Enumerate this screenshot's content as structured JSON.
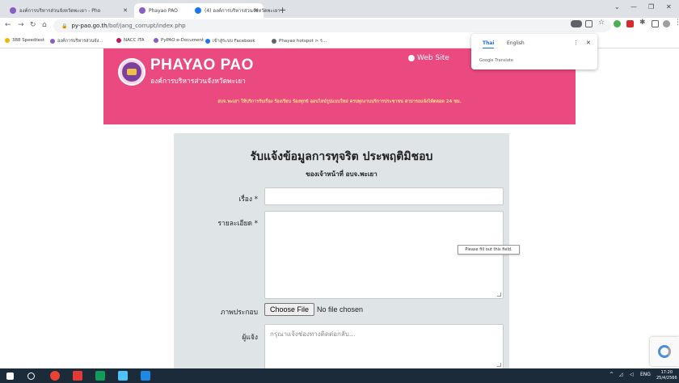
{
  "browser": {
    "tabs": [
      {
        "title": "องค์การบริหารส่วนจังหวัดพะเยา - Pho",
        "active": false,
        "favicon_color": "#8a5cc4"
      },
      {
        "title": "Phayao PAO",
        "active": true,
        "favicon_color": "#8a5cc4"
      },
      {
        "title": "(4) องค์การบริหารส่วนจังหวัดพะเยา | F",
        "active": false,
        "favicon_color": "#1877f2"
      }
    ],
    "new_tab": "+",
    "url_host": "py-pao.go.th",
    "url_path": "/bof/jang_corrupt/index.php",
    "bookmarks": [
      {
        "label": "388 Speedtest",
        "color": "#f4b400"
      },
      {
        "label": "องค์การบริหารส่วนจัง...",
        "color": "#8a5cc4"
      },
      {
        "label": "NACC ITA",
        "color": "#c2185b"
      },
      {
        "label": "PyPAO e-Document",
        "color": "#8a5cc4"
      },
      {
        "label": "เข้าสู่ระบบ Facebook",
        "color": "#1877f2"
      },
      {
        "label": "Phayao hotspot > ร...",
        "color": "#5f6368"
      }
    ],
    "translate_popup": {
      "lang_active": "Thai",
      "lang_other": "English",
      "brand": "Google Translate"
    }
  },
  "site": {
    "logo_title": "PHAYAO PAO",
    "logo_subtitle": "องค์การบริหารส่วนจังหวัดพะเยา",
    "website_link": "Web Site",
    "strip_text": "อบจ.พะเยา ให้บริการรับเรื่อง ร้องเรียน ร้องทุกข์ ออนไลน์รูปแบบใหม่ ครบทุกงานบริการประชาชน สามารถแจ้งได้ตลอด 24 ชม.",
    "banner_color": "#ea4a7f"
  },
  "form": {
    "title": "รับแจ้งข้อมูลการทุจริต ประพฤติมิชอบ",
    "subtitle": "ของเจ้าหน้าที่ อบจ.พะเยา",
    "subject_label": "เรื่อง *",
    "subject_value": "",
    "detail_label": "รายละเอียด *",
    "detail_value": "",
    "validation_tooltip": "Please fill out this field.",
    "attachment_label": "ภาพประกอบ",
    "file_button": "Choose File",
    "file_status": "No file chosen",
    "reporter_label": "ผู้แจ้ง",
    "reporter_placeholder": "กรุณาแจ้งช่องทางติดต่อกลับ..."
  },
  "taskbar": {
    "tray_lang": "ENG",
    "time": "17:20",
    "date": "25/4/2566"
  }
}
